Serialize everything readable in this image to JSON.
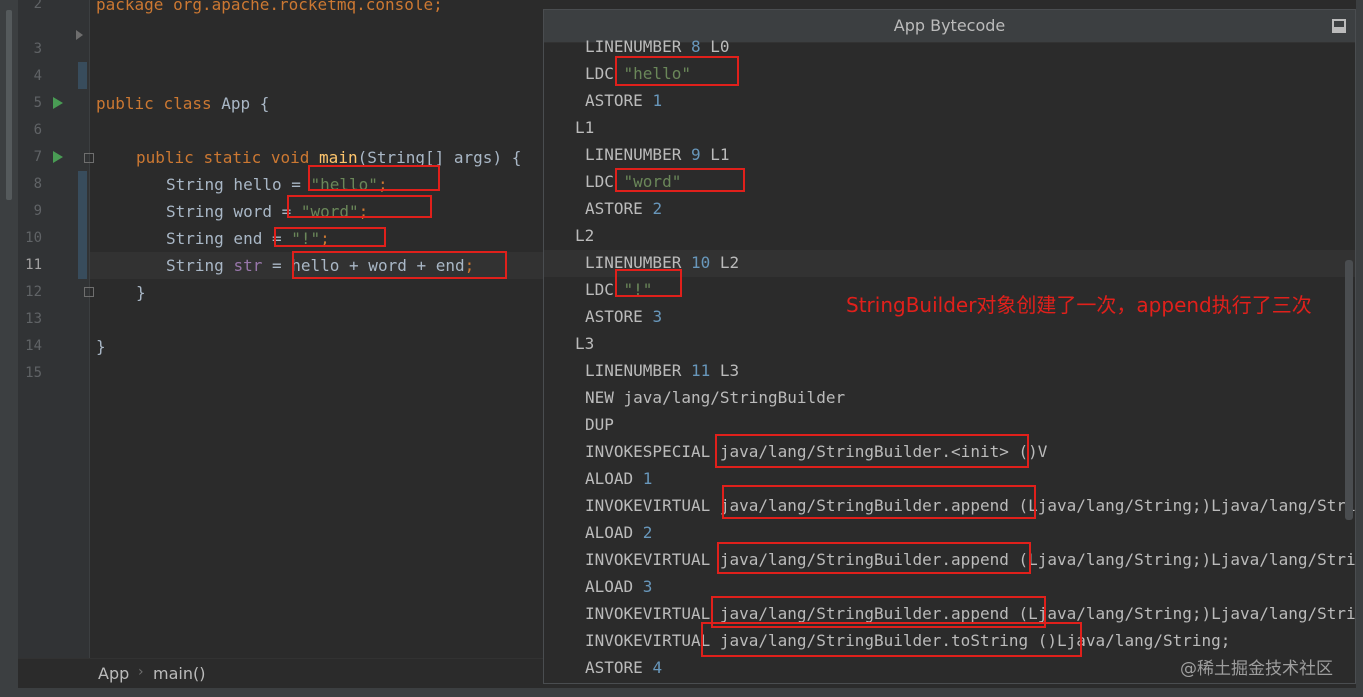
{
  "editor": {
    "line_numbers": [
      "2",
      "3",
      "4",
      "5",
      "6",
      "7",
      "8",
      "9",
      "10",
      "11",
      "12",
      "13",
      "14",
      "15"
    ],
    "current_line": "11",
    "lines": {
      "package": "package org.apache.rocketmq.console;",
      "class_kw1": "public",
      "class_kw2": "class",
      "class_name": "App {",
      "main_kw1": "public",
      "main_kw2": "static",
      "main_kw3": "void",
      "main_name": "main",
      "main_params": "(String[] args) {",
      "l8_decl": "String hello = ",
      "l8_val": "\"hello\"",
      "l8_end": ";",
      "l9_decl": "String word = ",
      "l9_val": "\"word\"",
      "l9_end": ";",
      "l10_decl": "String end = ",
      "l10_val": "\"!\"",
      "l10_end": ";",
      "l11_type": "String ",
      "l11_var": "str",
      "l11_expr": " = hello + word + end",
      "l11_end": ";",
      "close_method": "}",
      "close_class": "}"
    },
    "breadcrumb": [
      "App",
      "main()"
    ]
  },
  "bytecode_panel": {
    "title": "App Bytecode",
    "lines": {
      "b1_op": "LINENUMBER ",
      "b1_num": "8",
      "b1_lbl": " L0",
      "b2_op": "LDC ",
      "b2_val": "\"hello\"",
      "b3_op": "ASTORE ",
      "b3_num": "1",
      "b4_lbl": "L1",
      "b5_op": "LINENUMBER ",
      "b5_num": "9",
      "b5_lbl": " L1",
      "b6_op": "LDC ",
      "b6_val": "\"word\"",
      "b7_op": "ASTORE ",
      "b7_num": "2",
      "b8_lbl": "L2",
      "b9_op": "LINENUMBER ",
      "b9_num": "10",
      "b9_lbl": " L2",
      "b10_op": "LDC ",
      "b10_val": "\"!\"",
      "b11_op": "ASTORE ",
      "b11_num": "3",
      "b12_lbl": "L3",
      "b13_op": "LINENUMBER ",
      "b13_num": "11",
      "b13_lbl": " L3",
      "b14": "NEW java/lang/StringBuilder",
      "b15": "DUP",
      "b16": "INVOKESPECIAL java/lang/StringBuilder.<init> ()V",
      "b17_op": "ALOAD ",
      "b17_num": "1",
      "b18": "INVOKEVIRTUAL java/lang/StringBuilder.append (Ljava/lang/String;)Ljava/lang/StringBuilder;",
      "b19_op": "ALOAD ",
      "b19_num": "2",
      "b20": "INVOKEVIRTUAL java/lang/StringBuilder.append (Ljava/lang/String;)Ljava/lang/StringBuilder;",
      "b21_op": "ALOAD ",
      "b21_num": "3",
      "b22": "INVOKEVIRTUAL java/lang/StringBuilder.append (Ljava/lang/String;)Ljava/lang/StringBuilder;",
      "b23": "INVOKEVIRTUAL java/lang/StringBuilder.toString ()Ljava/lang/String;",
      "b24_op": "ASTORE ",
      "b24_num": "4"
    }
  },
  "annotation": "StringBuilder对象创建了一次，append执行了三次",
  "watermark": "@稀土掘金技术社区",
  "colors": {
    "background": "#2b2b2b",
    "keyword": "#cc7832",
    "string": "#6a8759",
    "number": "#6897bb",
    "method": "#ffc66d",
    "annotation_red": "#e0201b",
    "run_green": "#499c54"
  },
  "icons": [
    "run-gutter-icon",
    "fold-icon",
    "panel-minimize-icon"
  ]
}
